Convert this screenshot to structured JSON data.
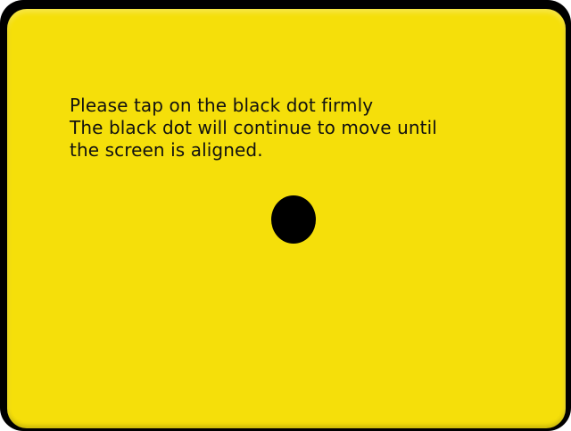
{
  "calibration": {
    "instruction_lines": [
      "Please tap on the black dot firmly",
      "The black dot will continue to move until",
      "the screen is aligned."
    ]
  },
  "colors": {
    "background": "#f5df0a",
    "frame": "#000000",
    "dot": "#000000",
    "text": "#111111"
  },
  "icons": {
    "target": "calibration-dot"
  }
}
